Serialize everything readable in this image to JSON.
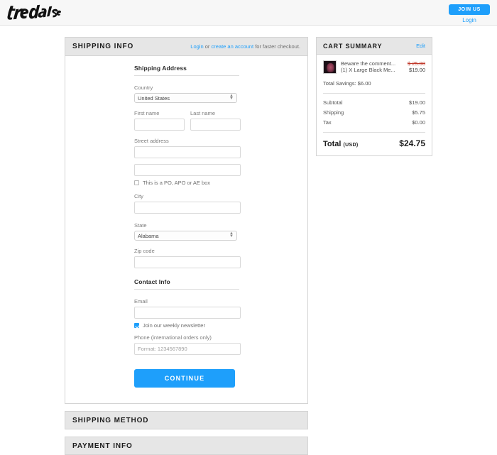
{
  "header": {
    "logo_text": "threadless",
    "join_label": "JOIN US",
    "login_label": "Login"
  },
  "shipping_info": {
    "title": "SHIPPING INFO",
    "note_login": "Login",
    "note_or": " or ",
    "note_create": "create an account",
    "note_tail": " for faster checkout.",
    "shipping_address_heading": "Shipping Address",
    "country_label": "Country",
    "country_value": "United States",
    "first_name_label": "First name",
    "first_name_value": "",
    "last_name_label": "Last name",
    "last_name_value": "",
    "street_label": "Street address",
    "street_1_value": "",
    "street_2_value": "",
    "po_box_label": "This is a PO, APO or AE box",
    "po_box_checked": false,
    "city_label": "City",
    "city_value": "",
    "state_label": "State",
    "state_value": "Alabama",
    "zip_label": "Zip code",
    "zip_value": "",
    "contact_info_heading": "Contact Info",
    "email_label": "Email",
    "email_value": "",
    "newsletter_label": "Join our weekly newsletter",
    "newsletter_checked": true,
    "phone_label": "Phone (international orders only)",
    "phone_placeholder": "Format: 1234567890",
    "phone_value": "",
    "continue_label": "CONTINUE"
  },
  "shipping_method": {
    "title": "SHIPPING METHOD"
  },
  "payment_info": {
    "title": "PAYMENT INFO"
  },
  "cart": {
    "title": "CART SUMMARY",
    "edit_label": "Edit",
    "item": {
      "name": "Beware the comment...",
      "variant": "(1) X Large Black Me...",
      "price_old": "$ 25.00",
      "price_new": "$19.00"
    },
    "savings": "Total Savings: $6.00",
    "lines": [
      {
        "label": "Subtotal",
        "value": "$19.00"
      },
      {
        "label": "Shipping",
        "value": "$5.75"
      },
      {
        "label": "Tax",
        "value": "$0.00"
      }
    ],
    "total_label": "Total",
    "total_currency": "(USD)",
    "total_value": "$24.75"
  },
  "colors": {
    "accent": "#1e9ffb",
    "panel_head": "#e6e6e6",
    "strike": "#c0392b"
  }
}
